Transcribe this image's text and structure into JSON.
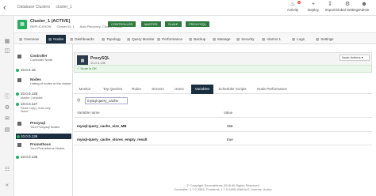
{
  "topbar": {
    "back_icon": "chevron-left-icon",
    "breadcrumbs": [
      "Database Clusters",
      "cluster_1"
    ],
    "buttons": [
      {
        "label": "Activity",
        "icon": "bell-icon",
        "badge": "1"
      },
      {
        "label": "Deploy",
        "icon": "plus-icon"
      },
      {
        "label": "Import",
        "icon": "import-icon"
      },
      {
        "label": "Global Settings",
        "icon": "gear-icon"
      },
      {
        "label": "Admin",
        "icon": "user-icon"
      }
    ]
  },
  "cluster": {
    "name": "Cluster_1 (ACTIVE)",
    "meta": [
      "REPLICATION",
      "Cluster ID: 1",
      "Auto Recovery: Cluster | Node"
    ],
    "roles": [
      "CONTROLLER",
      "MASTER",
      "SLAVE",
      "PROXYSQL"
    ]
  },
  "tabs": [
    "Overview",
    "Nodes",
    "Dashboards",
    "Topology",
    "Query Monitor",
    "Performance",
    "Backup",
    "Manage",
    "Security",
    "Alarms",
    "Logs",
    "Settings"
  ],
  "alarms_count": "1",
  "nodes": {
    "controller": {
      "title": "Controller",
      "sub": "Controller Node"
    },
    "controller_ip": "10.0.2.15",
    "db": {
      "title": "Nodes",
      "sub": "Listing of nodes in the cluster"
    },
    "db_ips": [
      {
        "ip": "10.0.0.125",
        "note": "Master | writable"
      },
      {
        "ip": "10.0.0.127",
        "note": "Read Copy | read only\nSlave"
      }
    ],
    "proxysql": {
      "title": "Proxysql",
      "sub": "Your Proxysql Nodes"
    },
    "proxysql_ip": "10.0.0.136",
    "prometheus": {
      "title": "Prometheus",
      "sub": "Your Prometheus Nodes"
    },
    "prometheus_ip": "10.0.0.136"
  },
  "panel": {
    "name": "ProxySQL",
    "sub": "10.0.0.136",
    "node_actions": "Node Actions",
    "status": "Node is OK",
    "tabs": [
      "Monitor",
      "Top Queries",
      "Rules",
      "Servers",
      "Users",
      "Variables",
      "Scheduler Scripts",
      "Node Performance"
    ],
    "active_tab": "Variables",
    "search_value": "mysql-query_cache",
    "table": {
      "headers": [
        "Variable name",
        "Value"
      ],
      "rows": [
        [
          "mysql-query_cache_size_MB",
          "256"
        ],
        [
          "mysql-query_cache_stores_empty_result",
          "true"
        ]
      ]
    }
  },
  "footer": {
    "line1": "© Copyright Severalnines 2018 All Rights Reserved",
    "line2": "Controller: 1.7.0.2904, Frontend: 1.7.0.5455-49bb3c3, License: Active"
  },
  "colors": {
    "nav_dark": "#1a2e40",
    "ok_green": "#27ae60",
    "role_green": "#2d7a3e"
  }
}
